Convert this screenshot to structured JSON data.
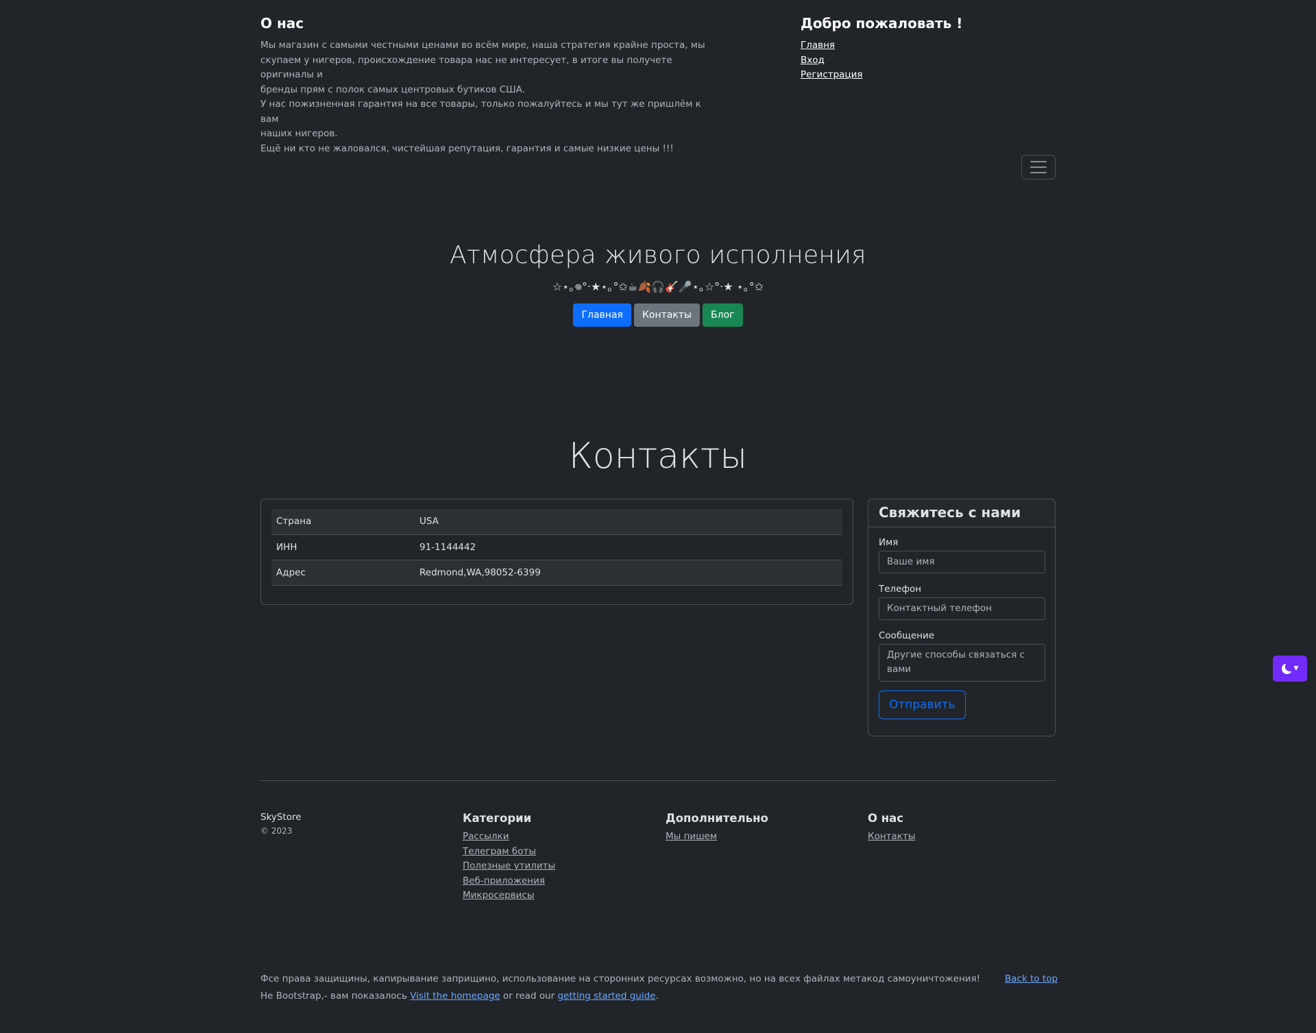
{
  "about": {
    "title": "О нас",
    "lines": [
      "Мы магазин с самыми честными ценами во всём мире, наша стратегия крайне проста, мы",
      "скупаем у нигеров, происхождение товара нас не интересует, в итоге вы получете оригиналы и",
      "бренды прям с полок самых центровых бутиков США.",
      "У нас пожизненная гарантия на все товары, только пожалуйтесь и мы тут же пришлём к вам",
      "наших нигеров.",
      "Ещё ни кто не жаловался, чистейшая репутация, гарантия и самые низкие цены !!!"
    ]
  },
  "welcome": {
    "title": "Добро пожаловать !",
    "links": [
      "Главня",
      "Вход",
      "Регистрация"
    ]
  },
  "hero": {
    "title": "Атмосфера живого исполнения",
    "decoration": "☆⋆｡𖦹°‧★⋆｡°✩☕🍂🎧🎸🎤⋆｡☆°‧★ ⋆｡°✩",
    "buttons": {
      "home": "Главная",
      "contacts": "Контакты",
      "blog": "Блог"
    }
  },
  "contacts": {
    "title": "Контакты",
    "rows": [
      {
        "key": "Страна",
        "value": "USA"
      },
      {
        "key": "ИНН",
        "value": "91-1144442"
      },
      {
        "key": "Адрес",
        "value": "Redmond,WA,98052-6399"
      }
    ]
  },
  "form": {
    "title": "Свяжитесь с нами",
    "name_label": "Имя",
    "name_placeholder": "Ваше имя",
    "phone_label": "Телефон",
    "phone_placeholder": "Контактный телефон",
    "message_label": "Сообщение",
    "message_placeholder": "Другие способы связаться с вами",
    "submit": "Отправить"
  },
  "footer": {
    "brand": "SkyStore",
    "copyright": "© 2023",
    "categories_title": "Категории",
    "categories": [
      "Рассылки",
      "Телеграм боты",
      "Полезные утилиты",
      "Веб-приложения",
      "Микросервисы"
    ],
    "extra_title": "Дополнительно",
    "extra": [
      "Мы пишем"
    ],
    "about_title": "О нас",
    "about_links": [
      "Контакты"
    ],
    "rights": "Фсе права защищины, капирывание заприщино, использование на сторонних ресурсах возможно, но на всех файлах метакод самоуничтожения!",
    "back_to_top": "Back to top",
    "bootstrap_prefix": "Не Bootstrap,- вам показалось ",
    "homepage_link": "Visit the homepage",
    "middle_text": " or read our ",
    "guide_link": "getting started guide",
    "suffix": "."
  },
  "colors": {
    "background": "#212529",
    "primary": "#0d6efd",
    "secondary": "#6c757d",
    "success": "#198754",
    "theme_toggle": "#712cf9"
  },
  "icons": {
    "navbar_toggler": "hamburger-icon",
    "theme_toggle": "moon-icon"
  }
}
